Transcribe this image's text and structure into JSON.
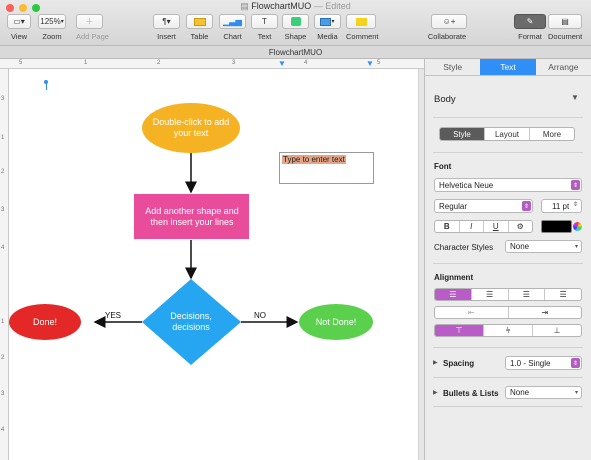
{
  "window": {
    "title": "FlowchartMUO",
    "status": "— Edited"
  },
  "toolbar": {
    "view": "View",
    "zoom_value": "125%",
    "zoom": "Zoom",
    "add_page": "Add Page",
    "insert": "Insert",
    "table": "Table",
    "chart": "Chart",
    "text": "Text",
    "shape": "Shape",
    "media": "Media",
    "comment": "Comment",
    "collaborate": "Collaborate",
    "format": "Format",
    "document": "Document"
  },
  "tab_title": "FlowchartMUO",
  "ruler": {
    "h_ticks": [
      "5",
      "1",
      "2",
      "3",
      "4",
      "5"
    ],
    "v_ticks": [
      "3",
      "1",
      "2",
      "3",
      "4",
      "1",
      "2",
      "3",
      "4"
    ]
  },
  "canvas": {
    "start_text": "Double-click to add your text",
    "textbox_placeholder": "Type to enter text",
    "process_text": "Add another shape and then insert your lines",
    "decision_text": "Decisions, decisions",
    "yes_label": "YES",
    "no_label": "NO",
    "done_text": "Done!",
    "not_done_text": "Not Done!"
  },
  "colors": {
    "start": "#f5b324",
    "process": "#e94c9a",
    "decision": "#26a5f0",
    "done": "#e42727",
    "not_done": "#5bd04c",
    "accent": "#2f8ff6"
  },
  "inspector": {
    "tabs": [
      "Style",
      "Text",
      "Arrange"
    ],
    "active_tab": "Text",
    "paragraph_style": "Body",
    "sub_tabs": [
      "Style",
      "Layout",
      "More"
    ],
    "font_section": "Font",
    "font_name": "Helvetica Neue",
    "font_weight": "Regular",
    "font_size": "11 pt",
    "format_buttons": [
      "B",
      "I",
      "U",
      "⚙"
    ],
    "character_styles_label": "Character Styles",
    "character_styles_value": "None",
    "alignment_label": "Alignment",
    "spacing_label": "Spacing",
    "spacing_value": "1.0 - Single",
    "bullets_label": "Bullets & Lists",
    "bullets_value": "None"
  }
}
